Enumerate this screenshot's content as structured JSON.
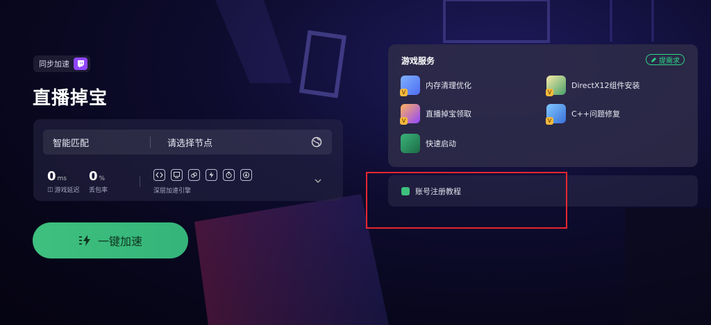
{
  "sync_tag": {
    "label": "同步加速"
  },
  "game": {
    "title": "直播掉宝"
  },
  "selector": {
    "mode": "智能匹配",
    "node_placeholder": "请选择节点"
  },
  "stats": {
    "latency": {
      "value": "0",
      "unit": "ms",
      "label": "游戏延迟"
    },
    "loss": {
      "value": "0",
      "unit": "%",
      "label": "丢包率"
    },
    "engine_label": "深层加速引擎"
  },
  "accelerate_button": {
    "label": "一键加速"
  },
  "services": {
    "title": "游戏服务",
    "request_label": "提需求",
    "items": [
      {
        "label": "内存清理优化",
        "icon": "memory-clean-icon"
      },
      {
        "label": "DirectX12组件安装",
        "icon": "directx-icon"
      },
      {
        "label": "直播掉宝领取",
        "icon": "stream-drops-icon"
      },
      {
        "label": "C++问题修复",
        "icon": "cpp-repair-icon"
      },
      {
        "label": "快速启动",
        "icon": "quick-launch-icon"
      }
    ]
  },
  "tutorial": {
    "label": "账号注册教程"
  },
  "colors": {
    "accent_green": "#3ec07e",
    "twitch_purple": "#9146ff",
    "highlight_red": "#e8272f"
  }
}
